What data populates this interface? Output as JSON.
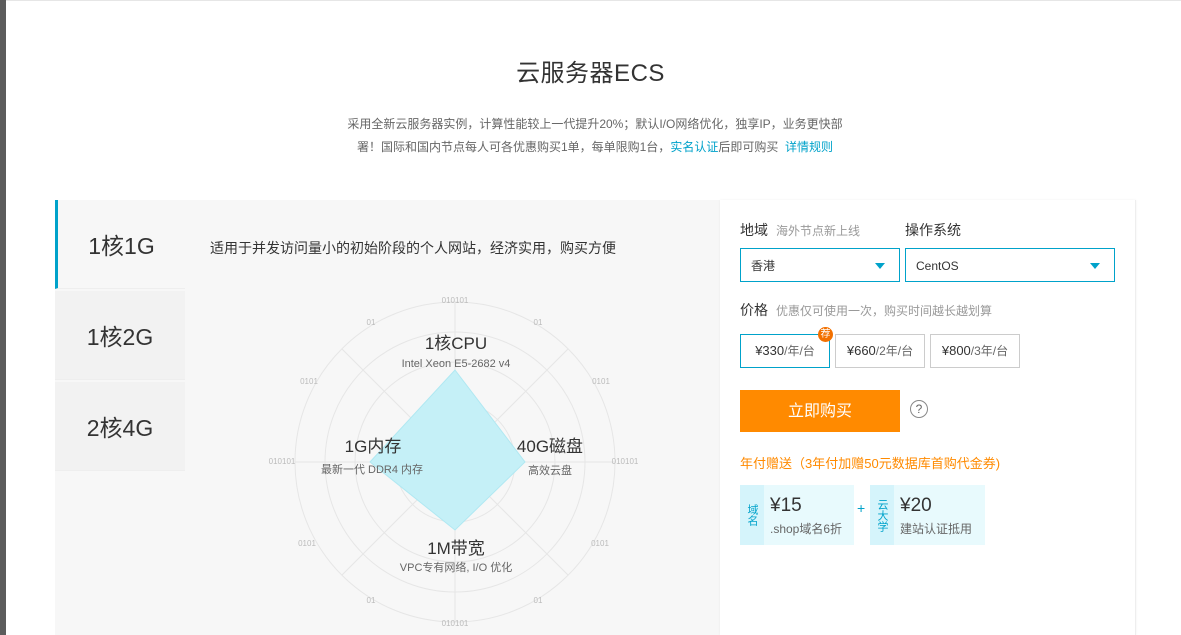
{
  "page": {
    "title": "云服务器ECS",
    "description_line1": "采用全新云服务器实例，计算性能较上一代提升20%；默认I/O网络优化，独享IP，业务更快部",
    "description_line2_prefix": "署！国际和国内节点每人可各优惠购买1单，每单限购1台，",
    "description_link1": "实名认证",
    "description_line2_middle": "后即可购买",
    "description_link2": "详情规则"
  },
  "tabs": [
    {
      "label": "1核1G",
      "active": true
    },
    {
      "label": "1核2G",
      "active": false
    },
    {
      "label": "2核4G",
      "active": false
    }
  ],
  "spec": {
    "description": "适用于并发访问量小的初始阶段的个人网站，经济实用，购买方便",
    "cpu_title": "1核CPU",
    "cpu_sub": "Intel Xeon E5-2682 v4",
    "disk_title": "40G磁盘",
    "disk_sub": "高效云盘",
    "bandwidth_title": "1M带宽",
    "bandwidth_sub": "VPC专有网络, I/O 优化",
    "memory_title": "1G内存",
    "memory_sub": "最新一代 DDR4 内存",
    "grid_labels": {
      "top": "010101",
      "bottom": "010101",
      "left": "010101",
      "right": "010101",
      "ring": "0101",
      "small": "01"
    },
    "radar_color": "#c5f0f7"
  },
  "order": {
    "region_label": "地域",
    "region_hint": "海外节点新上线",
    "region_value": "香港",
    "os_label": "操作系统",
    "os_value": "CentOS",
    "price_label": "价格",
    "price_hint": "优惠仅可使用一次，购买时间越长越划算",
    "prices": [
      {
        "amount": "¥330",
        "unit": "/年/台",
        "badge": "荐",
        "active": true
      },
      {
        "amount": "¥660",
        "unit": "/2年/台",
        "active": false
      },
      {
        "amount": "¥800",
        "unit": "/3年/台",
        "active": false
      }
    ],
    "buy_label": "立即购买",
    "help_label": "?",
    "promo_title": "年付赠送（3年付加赠50元数据库首购代金券)",
    "coupons": [
      {
        "tag": "域名",
        "amount": "¥15",
        "desc": ".shop域名6折"
      },
      {
        "tag": "云大学",
        "amount": "¥20",
        "desc": "建站认证抵用"
      }
    ],
    "plus": "+"
  },
  "colors": {
    "accent": "#00a2ca",
    "buy": "#ff8a00"
  }
}
